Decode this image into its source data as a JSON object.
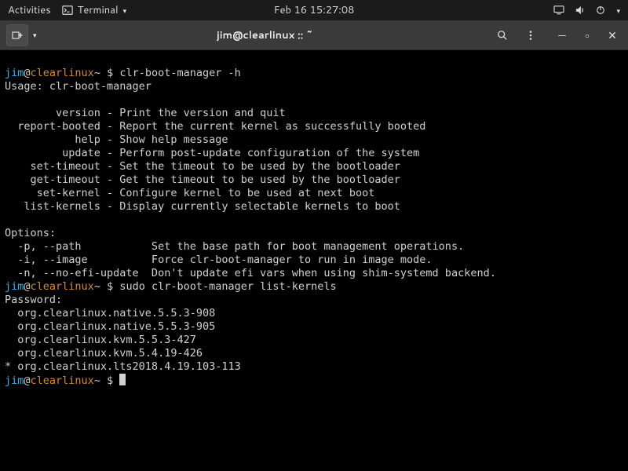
{
  "topbar": {
    "activities": "Activities",
    "app_name": "Terminal",
    "clock": "Feb 16  15:27:08"
  },
  "window": {
    "title": "jim@clearlinux :: ~"
  },
  "prompt": {
    "user": "jim",
    "at": "@",
    "host": "clearlinux",
    "tilde": "~",
    "dollar": " $ "
  },
  "cmd1": "clr-boot-manager -h",
  "usage": "Usage: clr-boot-manager",
  "sub": {
    "l1": "        version - Print the version and quit",
    "l2": "  report-booted - Report the current kernel as successfully booted",
    "l3": "           help - Show help message",
    "l4": "         update - Perform post-update configuration of the system",
    "l5": "    set-timeout - Set the timeout to be used by the bootloader",
    "l6": "    get-timeout - Get the timeout to be used by the bootloader",
    "l7": "     set-kernel - Configure kernel to be used at next boot",
    "l8": "   list-kernels - Display currently selectable kernels to boot"
  },
  "opts_hdr": "Options:",
  "opts": {
    "l1": "  -p, --path           Set the base path for boot management operations.",
    "l2": "  -i, --image          Force clr-boot-manager to run in image mode.",
    "l3": "  -n, --no-efi-update  Don't update efi vars when using shim-systemd backend."
  },
  "cmd2": "sudo clr-boot-manager list-kernels",
  "pwd": "Password:",
  "kernels": {
    "k1": "  org.clearlinux.native.5.5.3-908",
    "k2": "  org.clearlinux.native.5.5.3-905",
    "k3": "  org.clearlinux.kvm.5.5.3-427",
    "k4": "  org.clearlinux.kvm.5.4.19-426",
    "k5": "* org.clearlinux.lts2018.4.19.103-113"
  }
}
